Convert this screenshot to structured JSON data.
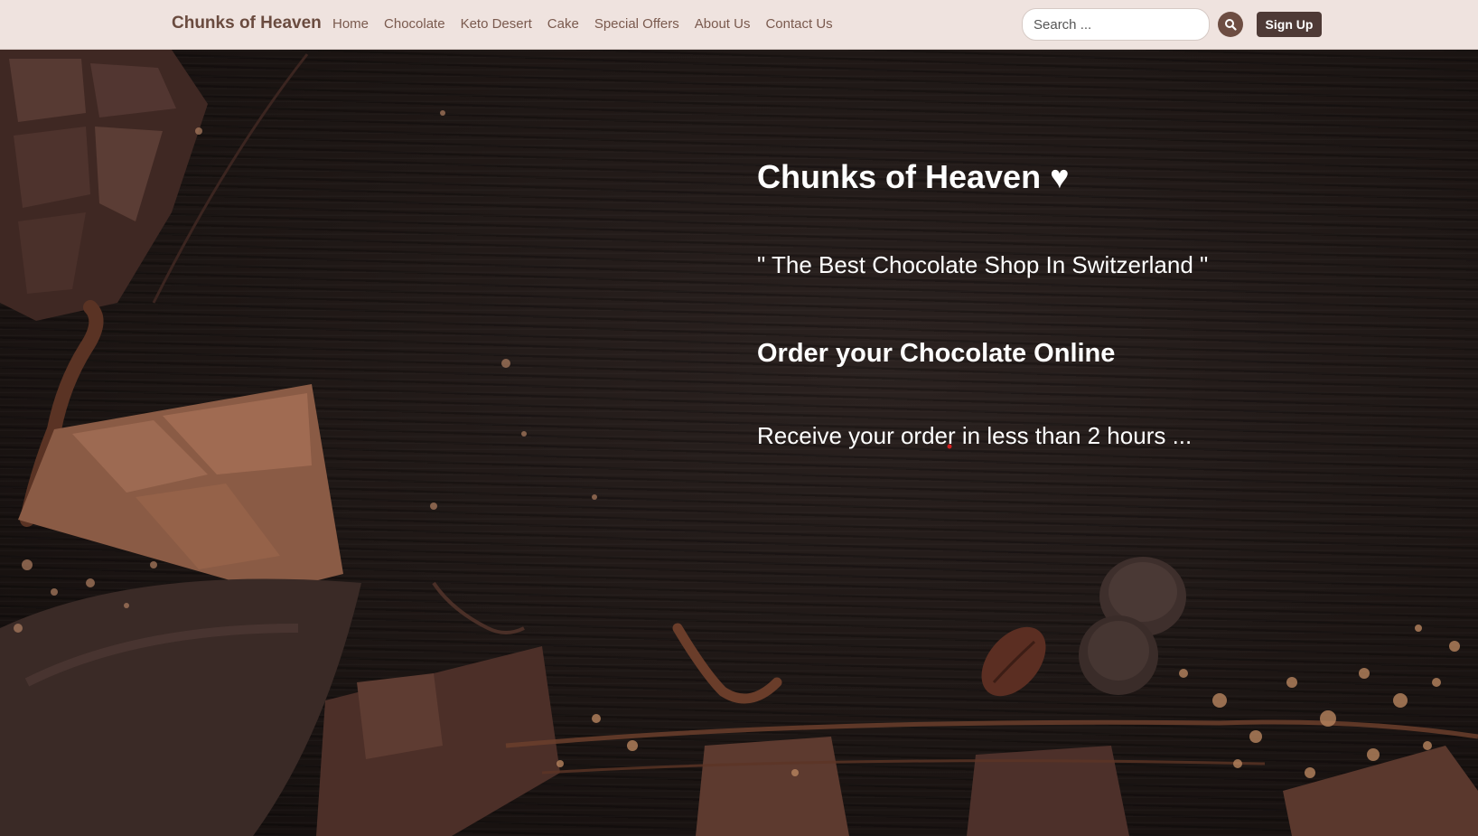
{
  "nav": {
    "brand": "Chunks of Heaven",
    "links": [
      "Home",
      "Chocolate",
      "Keto Desert",
      "Cake",
      "Special Offers",
      "About Us",
      "Contact Us"
    ],
    "search_placeholder": "Search ...",
    "search_icon": "search-icon",
    "signup_label": "Sign Up"
  },
  "hero": {
    "title": "Chunks of Heaven ♥",
    "tagline": "\" The Best Chocolate Shop In Switzerland \"",
    "order": "Order your Chocolate Online",
    "delivery": "Receive your order in less than 2 hours ..."
  },
  "colors": {
    "navbar_bg": "#efe3df",
    "brand_text": "#6a4b3f",
    "signup_bg": "#4e3a36",
    "hero_bg": "#1d1614"
  }
}
